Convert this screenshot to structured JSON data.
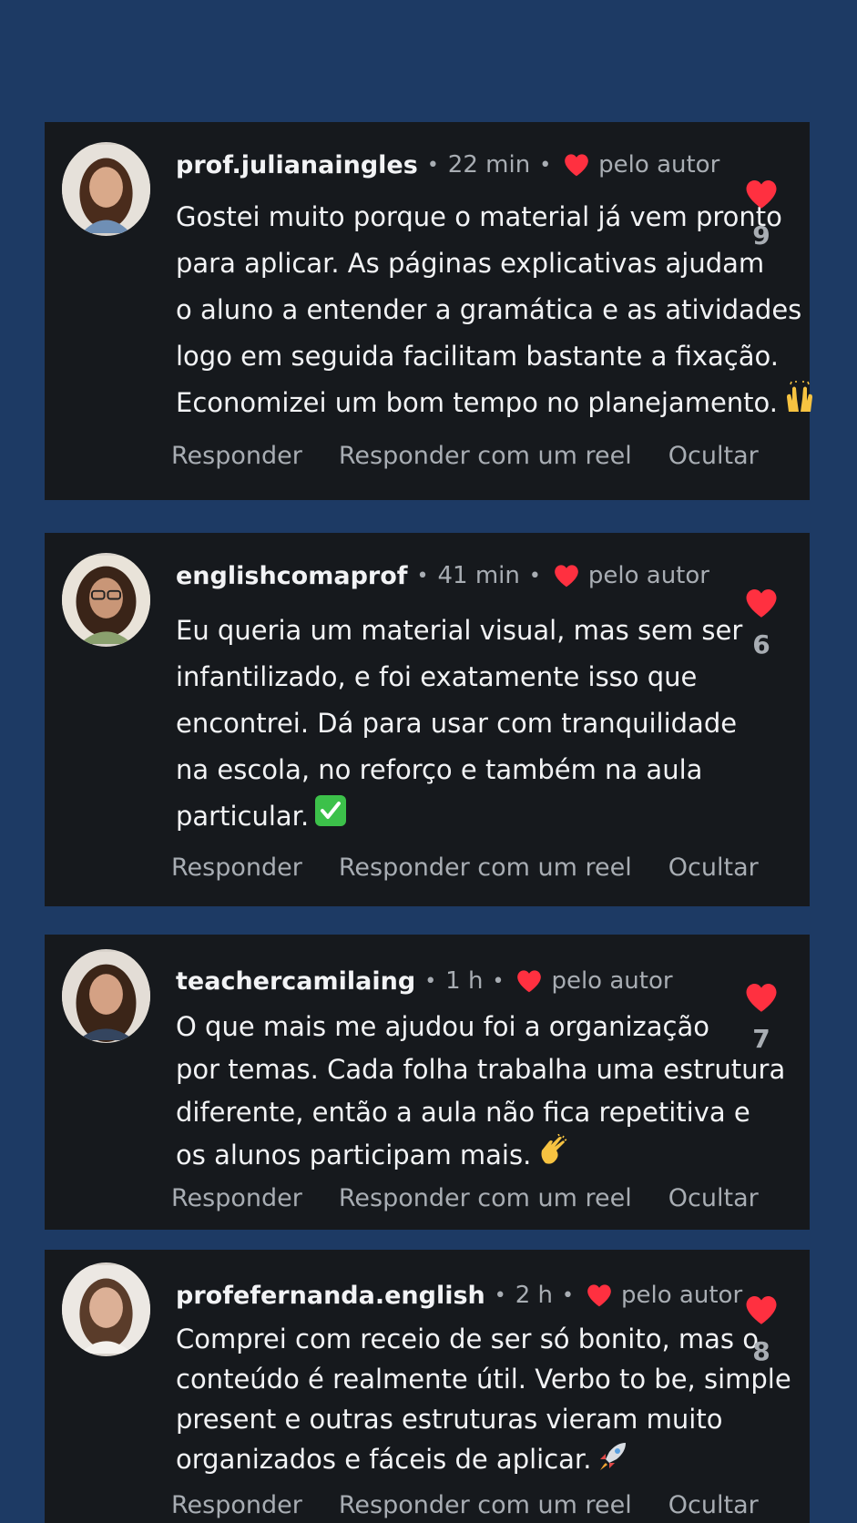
{
  "colors": {
    "background": "#1d3a64",
    "card": "#16191d",
    "heart": "#ff3040",
    "muted": "#a8adb3",
    "text": "#f2f3f5"
  },
  "comments": [
    {
      "username": "prof.julianaingles",
      "time": "22 min",
      "author_badge": "pelo autor",
      "lines": [
        "Gostei muito porque o material já vem pronto",
        "para aplicar. As páginas explicativas ajudam",
        "o aluno a entender a gramática e as atividades",
        "logo em seguida facilitam bastante a fixação.",
        "Economizei um bom tempo no planejamento."
      ],
      "emoji": "raising-hands-icon",
      "likes": "9",
      "actions": [
        "Responder",
        "Responder com um reel",
        "Ocultar"
      ]
    },
    {
      "username": "englishcomaprof",
      "time": "41 min",
      "author_badge": "pelo autor",
      "lines": [
        "Eu queria um material visual, mas sem ser",
        "infantilizado, e foi exatamente isso que",
        "encontrei. Dá para usar com tranquilidade",
        "na escola, no reforço e também na aula",
        "particular."
      ],
      "emoji": "check-mark-icon",
      "likes": "6",
      "actions": [
        "Responder",
        "Responder com um reel",
        "Ocultar"
      ]
    },
    {
      "username": "teachercamilaing",
      "time": "1 h",
      "author_badge": "pelo autor",
      "lines": [
        "O que mais me ajudou foi a organização",
        "por temas. Cada folha trabalha uma estrutura",
        "diferente, então a aula não fica repetitiva e",
        "os alunos participam mais."
      ],
      "emoji": "clapping-hands-icon",
      "likes": "7",
      "actions": [
        "Responder",
        "Responder com um reel",
        "Ocultar"
      ]
    },
    {
      "username": "profefernanda.english",
      "time": "2 h",
      "author_badge": "pelo autor",
      "lines": [
        "Comprei com receio de ser só bonito, mas o",
        "conteúdo é realmente útil. Verbo to be, simple",
        "present e outras estruturas vieram muito",
        "organizados e fáceis de aplicar."
      ],
      "emoji": "rocket-icon",
      "likes": "8",
      "actions": [
        "Responder",
        "Responder com um reel",
        "Ocultar"
      ]
    }
  ]
}
